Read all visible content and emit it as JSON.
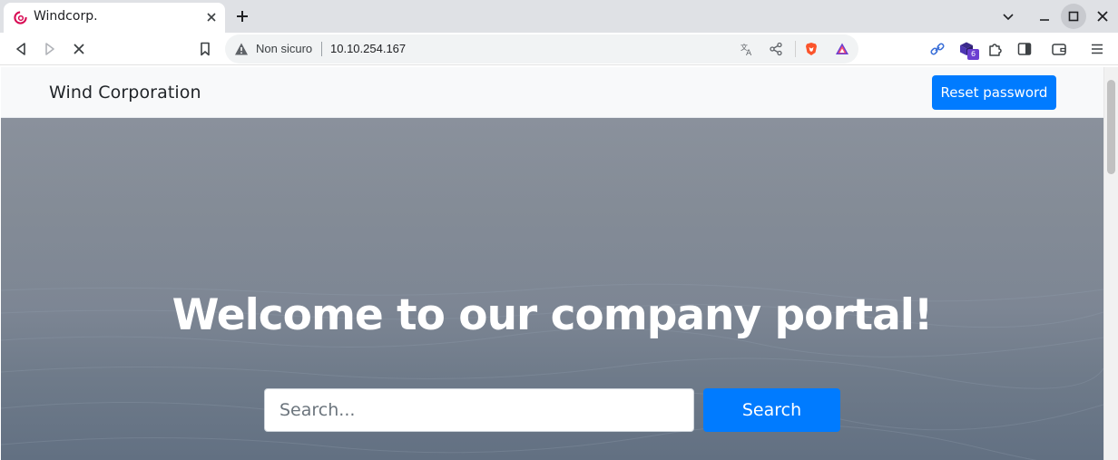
{
  "browser": {
    "tab": {
      "title": "Windcorp."
    },
    "omnibox": {
      "security_label": "Non sicuro",
      "url": "10.10.254.167"
    },
    "extension_badge_count": "6",
    "icons": {
      "favicon": "debian-swirl-icon",
      "tab_close": "close-icon",
      "new_tab": "plus-icon",
      "back": "back-icon",
      "forward": "forward-icon",
      "stop": "stop-icon",
      "bookmark": "bookmark-icon",
      "warning": "warning-icon",
      "translate": "translate-icon",
      "share": "share-icon",
      "brave": "brave-shield-icon",
      "rewards": "brave-rewards-icon",
      "link_ext": "link-extension-icon",
      "cube_ext": "cube-extension-icon",
      "extensions": "puzzle-icon",
      "sidebar": "sidebar-icon",
      "wallet": "wallet-icon",
      "menu": "hamburger-icon"
    }
  },
  "page": {
    "brand": "Wind Corporation",
    "reset_button": "Reset password",
    "hero_title": "Welcome to our company portal!",
    "search": {
      "placeholder": "Search...",
      "value": "",
      "button": "Search"
    },
    "colors": {
      "primary": "#007bff",
      "navbar_bg": "#f8f9fa"
    }
  }
}
